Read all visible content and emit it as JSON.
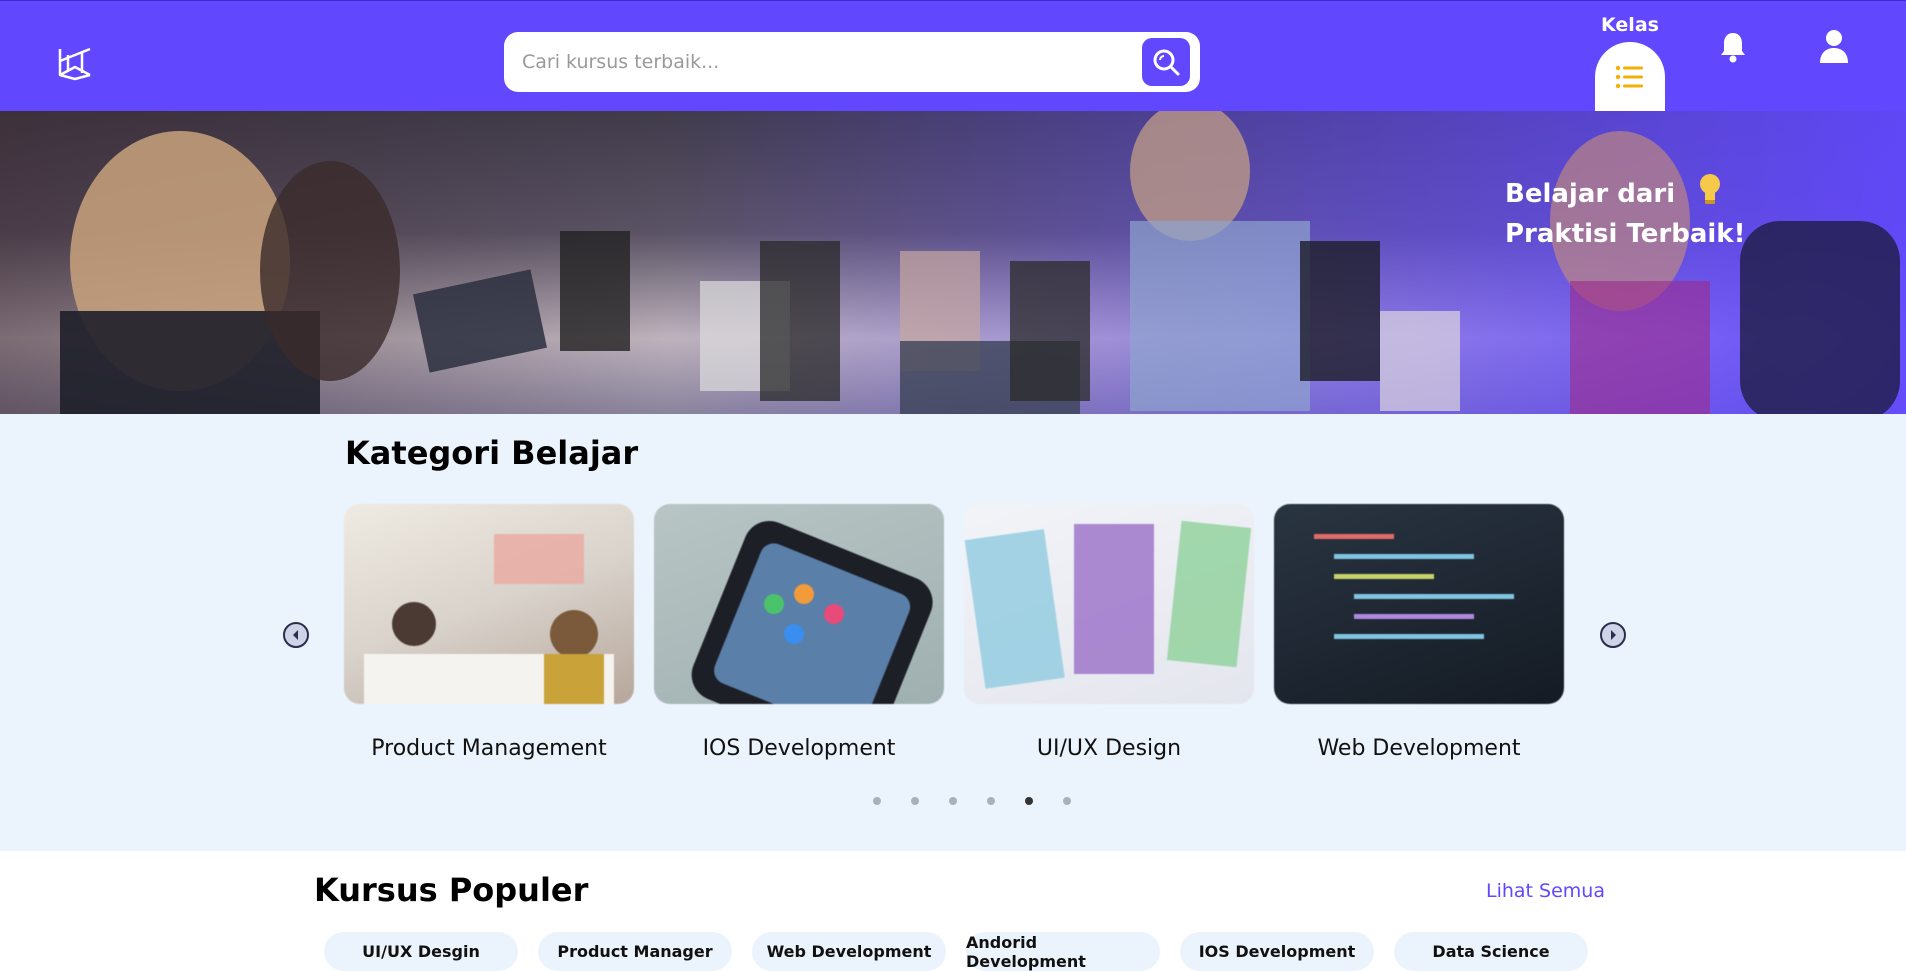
{
  "header": {
    "search_placeholder": "Cari kursus terbaik...",
    "kelas_label": "Kelas",
    "brand_color": "#6148FF"
  },
  "hero": {
    "title_line1": "Belajar dari",
    "title_line2": "Praktisi Terbaik!"
  },
  "kategori": {
    "title": "Kategori Belajar",
    "items": [
      {
        "label": "Product Management"
      },
      {
        "label": "IOS Development"
      },
      {
        "label": "UI/UX Design"
      },
      {
        "label": "Web Development"
      }
    ],
    "dots_total": 6,
    "dots_active": 5
  },
  "populer": {
    "title": "Kursus Populer",
    "see_all": "Lihat Semua",
    "chips": [
      "UI/UX Desgin",
      "Product Manager",
      "Web Development",
      "Andorid Development",
      "IOS Development",
      "Data Science"
    ]
  }
}
